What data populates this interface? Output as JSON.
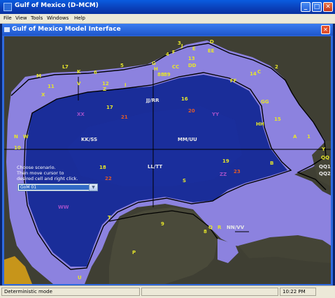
{
  "app": {
    "title": "Gulf of Mexico (D-MCM)",
    "window_buttons": {
      "minimize": "_",
      "maximize": "□",
      "close": "✕"
    }
  },
  "menu": [
    "File",
    "View",
    "Tools",
    "Windows",
    "Help"
  ],
  "child_window": {
    "title": "Gulf of Mexico Model Interface",
    "close": "✕"
  },
  "scenario": {
    "instructions": [
      "Choose scenario.",
      "Then move cursor to",
      "desired cell and right click."
    ],
    "selected": "GoM 01",
    "arrow": "▼"
  },
  "status": {
    "mode": "Deterministic mode",
    "time": "10:22 PM"
  },
  "colors": {
    "deep_water": "#1a2d99",
    "shelf": "#8c82df",
    "land": "#3f3f33",
    "zone_label": "#e6e62a",
    "region_label": "#d8d8d8",
    "red_label": "#e05a2a",
    "purple_label": "#a050c8"
  },
  "map": {
    "zone_labels": [
      "A",
      "B",
      "C",
      "D",
      "E",
      "EE",
      "F",
      "FF",
      "G",
      "GG",
      "H",
      "HH",
      "I",
      "J",
      "K",
      "L",
      "M",
      "N",
      "O",
      "P",
      "Q",
      "R",
      "S",
      "T",
      "U",
      "V",
      "W",
      "X",
      "Y",
      "Z",
      "DD",
      "CC",
      "1",
      "2",
      "3",
      "4",
      "5",
      "6",
      "7",
      "8",
      "9",
      "10",
      "11",
      "12",
      "13",
      "14",
      "15",
      "16",
      "17",
      "18",
      "19",
      "88",
      "89",
      "QQ"
    ],
    "region_labels": [
      "JJ/RR",
      "KK/SS",
      "MM/UU",
      "LL/TT",
      "NN/VV",
      "QQ1",
      "QQ2"
    ],
    "red_labels": [
      "20",
      "21",
      "22",
      "23"
    ],
    "purple_labels": [
      "XX",
      "YY",
      "ZZ",
      "WW"
    ]
  }
}
